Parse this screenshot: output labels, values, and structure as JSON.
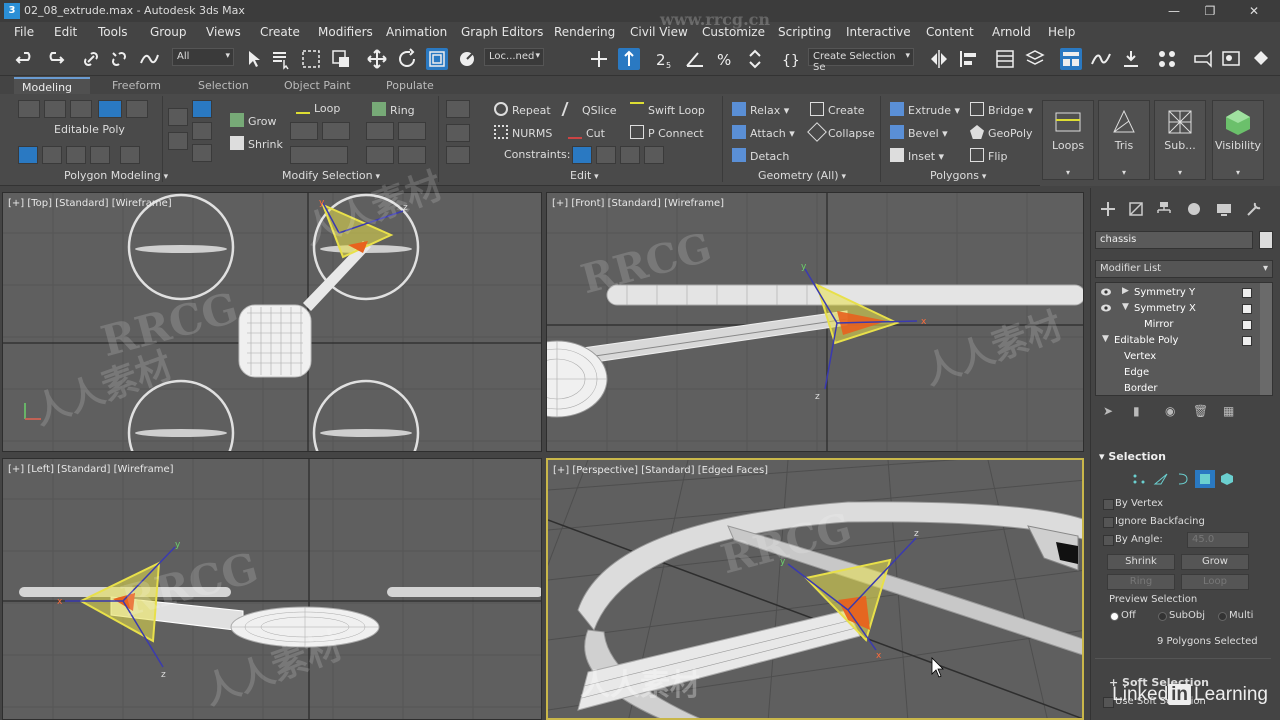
{
  "app": {
    "title": "02_08_extrude.max - Autodesk 3ds Max",
    "icon": "3"
  },
  "menu": [
    "File",
    "Edit",
    "Tools",
    "Group",
    "Views",
    "Create",
    "Modifiers",
    "Animation",
    "Graph Editors",
    "Rendering",
    "Civil View",
    "Customize",
    "Scripting",
    "Interactive",
    "Content",
    "Arnold",
    "Help"
  ],
  "toolbar": {
    "filter_value": "All",
    "coord_value": "Loc...ned",
    "selection_set_placeholder": "Create Selection Se"
  },
  "ribbon": {
    "tabs": [
      "Modeling",
      "Freeform",
      "Selection",
      "Object Paint",
      "Populate"
    ],
    "active_tab": "Modeling",
    "polygon_modeling": {
      "title": "Polygon Modeling",
      "object_label": "Editable Poly"
    },
    "modify_selection": {
      "title": "Modify Selection",
      "grow": "Grow",
      "shrink": "Shrink",
      "loop": "Loop",
      "ring": "Ring"
    },
    "edit": {
      "title": "Edit",
      "repeat": "Repeat",
      "qslice": "QSlice",
      "swift_loop": "Swift Loop",
      "nurms": "NURMS",
      "cut": "Cut",
      "p_connect": "P Connect",
      "constraints": "Constraints:"
    },
    "geometry": {
      "title": "Geometry (All)",
      "relax": "Relax",
      "create": "Create",
      "attach": "Attach",
      "collapse": "Collapse",
      "detach": "Detach"
    },
    "polygons": {
      "title": "Polygons",
      "extrude": "Extrude",
      "bridge": "Bridge",
      "bevel": "Bevel",
      "geopoly": "GeoPoly",
      "inset": "Inset",
      "flip": "Flip"
    },
    "big_buttons": [
      "Loops",
      "Tris",
      "Sub...",
      "Visibility"
    ]
  },
  "viewports": {
    "top": "[+] [Top] [Standard] [Wireframe]",
    "front": "[+] [Front] [Standard] [Wireframe]",
    "left": "[+] [Left] [Standard] [Wireframe]",
    "perspective": "[+] [Perspective] [Standard] [Edged Faces]",
    "axis": {
      "x": "x",
      "y": "y",
      "z": "z"
    }
  },
  "command_panel": {
    "object_name": "chassis",
    "modifier_list": "Modifier List",
    "stack": [
      {
        "label": "Symmetry Y",
        "level": 0
      },
      {
        "label": "Symmetry X",
        "level": 0
      },
      {
        "label": "Mirror",
        "level": 1
      },
      {
        "label": "Editable Poly",
        "level": 0
      },
      {
        "label": "Vertex",
        "level": 1
      },
      {
        "label": "Edge",
        "level": 1
      },
      {
        "label": "Border",
        "level": 1
      }
    ],
    "selection": {
      "title": "Selection",
      "by_vertex": "By Vertex",
      "ignore_backfacing": "Ignore Backfacing",
      "by_angle": "By Angle:",
      "by_angle_value": "45.0",
      "shrink": "Shrink",
      "grow": "Grow",
      "ring": "Ring",
      "loop": "Loop",
      "preview_selection": "Preview Selection",
      "preview_off": "Off",
      "preview_subobj": "SubObj",
      "preview_multi": "Multi",
      "status": "9 Polygons Selected",
      "soft_selection": "Soft Selection",
      "use_soft_selection": "Use Soft Selection"
    }
  },
  "watermark": {
    "brand": "LinkedIn Learning",
    "brand_in": "in",
    "brand_pre": "Linked",
    "brand_post": "Learning",
    "rrcg": "RRCG",
    "cn": "人人素材",
    "url": "www.rrcg.cn"
  },
  "colors": {
    "accent_blue": "#2a79c2",
    "active_viewport": "#c9b74a",
    "gizmo_yellow": "#e8e04a",
    "selection_orange": "#e8621e"
  }
}
